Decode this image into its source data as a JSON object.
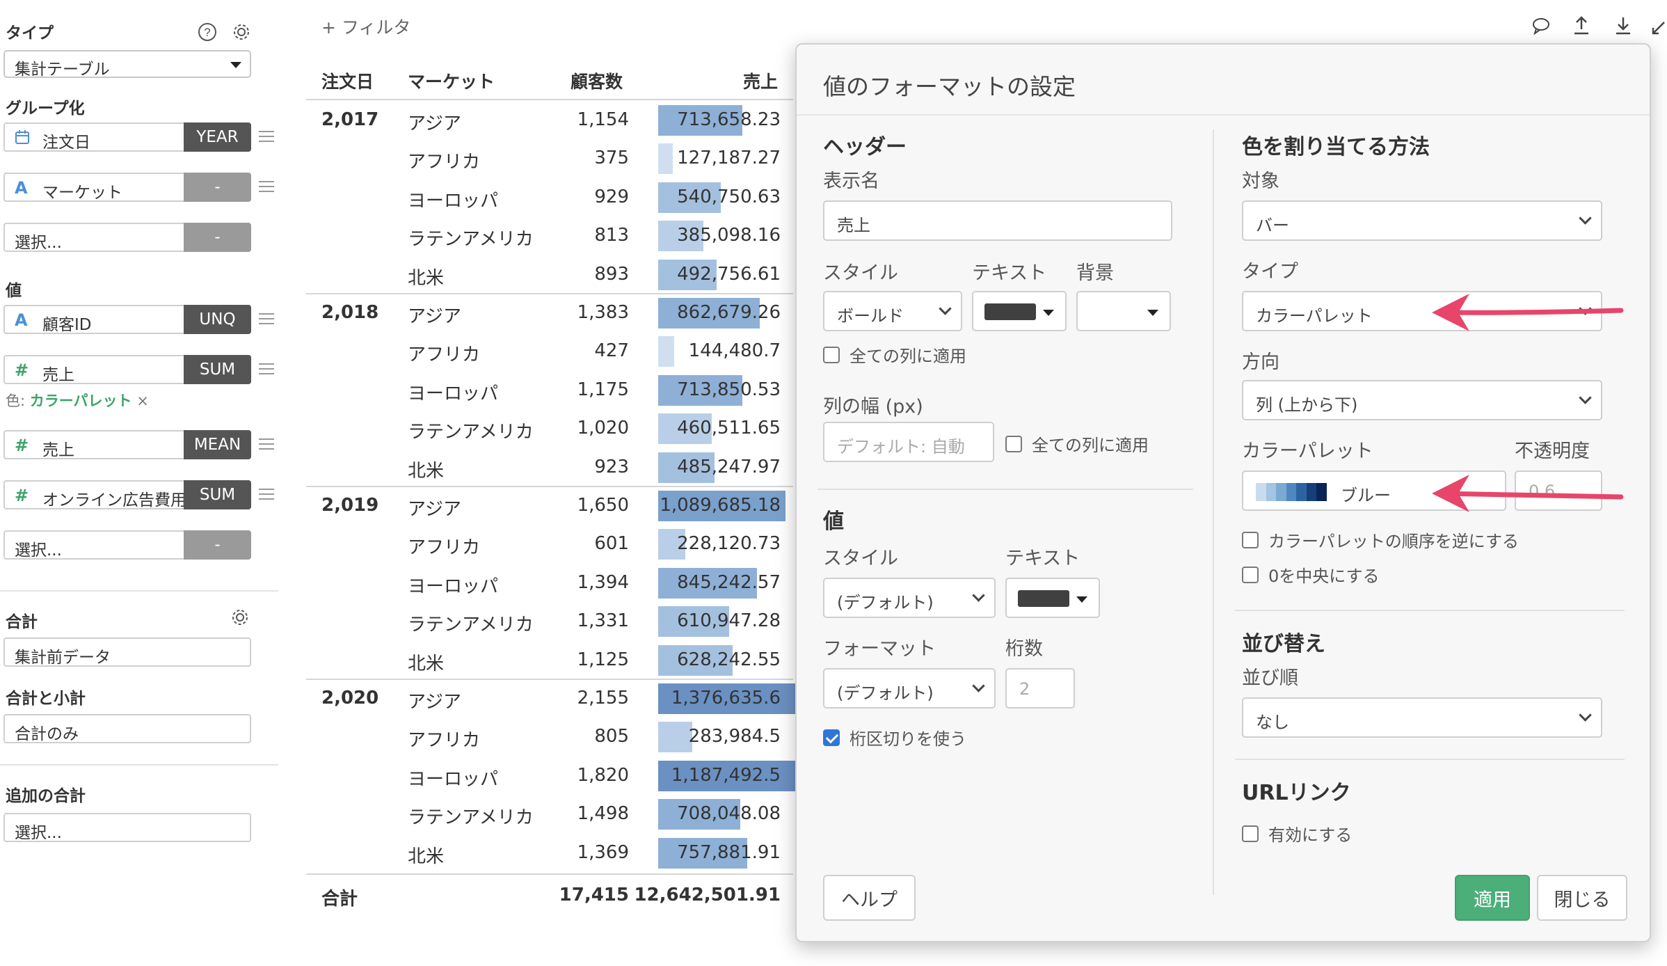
{
  "left_panel": {
    "type_title": "タイプ",
    "type_value": "集計テーブル",
    "group_title": "グループ化",
    "group_fields": [
      {
        "icon": "📅",
        "label": "注文日",
        "agg": "YEAR"
      },
      {
        "icon": "A",
        "label": "マーケット",
        "agg": "-"
      },
      {
        "icon": "",
        "label": "選択...",
        "agg": "-"
      }
    ],
    "value_title": "値",
    "value_fields": [
      {
        "icon": "A",
        "label": "顧客ID",
        "agg": "UNQ"
      },
      {
        "icon": "#",
        "label": "売上",
        "agg": "SUM"
      },
      {
        "icon": "#",
        "label": "売上",
        "agg": "MEAN"
      },
      {
        "icon": "#",
        "label": "オンライン広告費用",
        "agg": "SUM"
      },
      {
        "icon": "",
        "label": "選択...",
        "agg": "-"
      }
    ],
    "color_note_prefix": "色:",
    "color_note_value": "カラーパレット",
    "color_note_remove": "×",
    "total_title": "合計",
    "total_value": "集計前データ",
    "subtotal_title": "合計と小計",
    "subtotal_value": "合計のみ",
    "extra_total_title": "追加の合計",
    "extra_total_value": "選択..."
  },
  "table": {
    "filter_label": "+ フィルタ",
    "headers": {
      "date": "注文日",
      "market": "マーケット",
      "customers": "顧客数",
      "sales": "売上"
    },
    "groups": [
      {
        "year": "2,017",
        "rows": [
          {
            "market": "アジア",
            "customers": "1,154",
            "sales": "713,658.23",
            "level": 0.52
          },
          {
            "market": "アフリカ",
            "customers": "375",
            "sales": "127,187.27",
            "level": 0.09
          },
          {
            "market": "ヨーロッパ",
            "customers": "929",
            "sales": "540,750.63",
            "level": 0.39
          },
          {
            "market": "ラテンアメリカ",
            "customers": "813",
            "sales": "385,098.16",
            "level": 0.28
          },
          {
            "market": "北米",
            "customers": "893",
            "sales": "492,756.61",
            "level": 0.36
          }
        ]
      },
      {
        "year": "2,018",
        "rows": [
          {
            "market": "アジア",
            "customers": "1,383",
            "sales": "862,679.26",
            "level": 0.63
          },
          {
            "market": "アフリカ",
            "customers": "427",
            "sales": "144,480.7",
            "level": 0.1
          },
          {
            "market": "ヨーロッパ",
            "customers": "1,175",
            "sales": "713,850.53",
            "level": 0.52
          },
          {
            "market": "ラテンアメリカ",
            "customers": "1,020",
            "sales": "460,511.65",
            "level": 0.33
          },
          {
            "market": "北米",
            "customers": "923",
            "sales": "485,247.97",
            "level": 0.35
          }
        ]
      },
      {
        "year": "2,019",
        "rows": [
          {
            "market": "アジア",
            "customers": "1,650",
            "sales": "1,089,685.18",
            "level": 0.79
          },
          {
            "market": "アフリカ",
            "customers": "601",
            "sales": "228,120.73",
            "level": 0.17
          },
          {
            "market": "ヨーロッパ",
            "customers": "1,394",
            "sales": "845,242.57",
            "level": 0.61
          },
          {
            "market": "ラテンアメリカ",
            "customers": "1,331",
            "sales": "610,947.28",
            "level": 0.44
          },
          {
            "market": "北米",
            "customers": "1,125",
            "sales": "628,242.55",
            "level": 0.46
          }
        ]
      },
      {
        "year": "2,020",
        "rows": [
          {
            "market": "アジア",
            "customers": "2,155",
            "sales": "1,376,635.6",
            "level": 1.0
          },
          {
            "market": "アフリカ",
            "customers": "805",
            "sales": "283,984.5",
            "level": 0.21
          },
          {
            "market": "ヨーロッパ",
            "customers": "1,820",
            "sales": "1,187,492.5",
            "level": 0.86
          },
          {
            "market": "ラテンアメリカ",
            "customers": "1,498",
            "sales": "708,048.08",
            "level": 0.51
          },
          {
            "market": "北米",
            "customers": "1,369",
            "sales": "757,881.91",
            "level": 0.55
          }
        ]
      }
    ],
    "total_label": "合計",
    "total_customers": "17,415",
    "total_sales": "12,642,501.91"
  },
  "dialog": {
    "title": "値のフォーマットの設定",
    "header_section": "ヘッダー",
    "display_name_label": "表示名",
    "display_name_value": "売上",
    "style_label": "スタイル",
    "text_label": "テキスト",
    "bg_label": "背景",
    "header_style_value": "ボールド",
    "apply_all_cols": "全ての列に適用",
    "col_width_label": "列の幅 (px)",
    "col_width_placeholder": "デフォルト: 自動",
    "apply_all_cols_2": "全ての列に適用",
    "value_section": "値",
    "value_style_label": "スタイル",
    "value_text_label": "テキスト",
    "value_style_value": "(デフォルト)",
    "format_label": "フォーマット",
    "digits_label": "桁数",
    "format_value": "(デフォルト)",
    "digits_placeholder": "2",
    "thousands_sep": "桁区切りを使う",
    "color_section": "色を割り当てる方法",
    "target_label": "対象",
    "target_value": "バー",
    "type_label": "タイプ",
    "type_value": "カラーパレット",
    "direction_label": "方向",
    "direction_value": "列 (上から下)",
    "palette_label": "カラーパレット",
    "opacity_label": "不透明度",
    "palette_value": "ブルー",
    "opacity_placeholder": "0.6",
    "reverse_palette": "カラーパレットの順序を逆にする",
    "center_zero": "0を中央にする",
    "sort_section": "並び替え",
    "sort_order_label": "並び順",
    "sort_value": "なし",
    "url_section": "URLリンク",
    "url_enable": "有効にする",
    "help_btn": "ヘルプ",
    "apply_btn": "適用",
    "close_btn": "閉じる"
  },
  "colors": {
    "accent_green": "#4caf7a",
    "bar_base": "#7fa3cf",
    "arrow": "#e8456b",
    "checkbox_blue": "#2f76d6"
  }
}
